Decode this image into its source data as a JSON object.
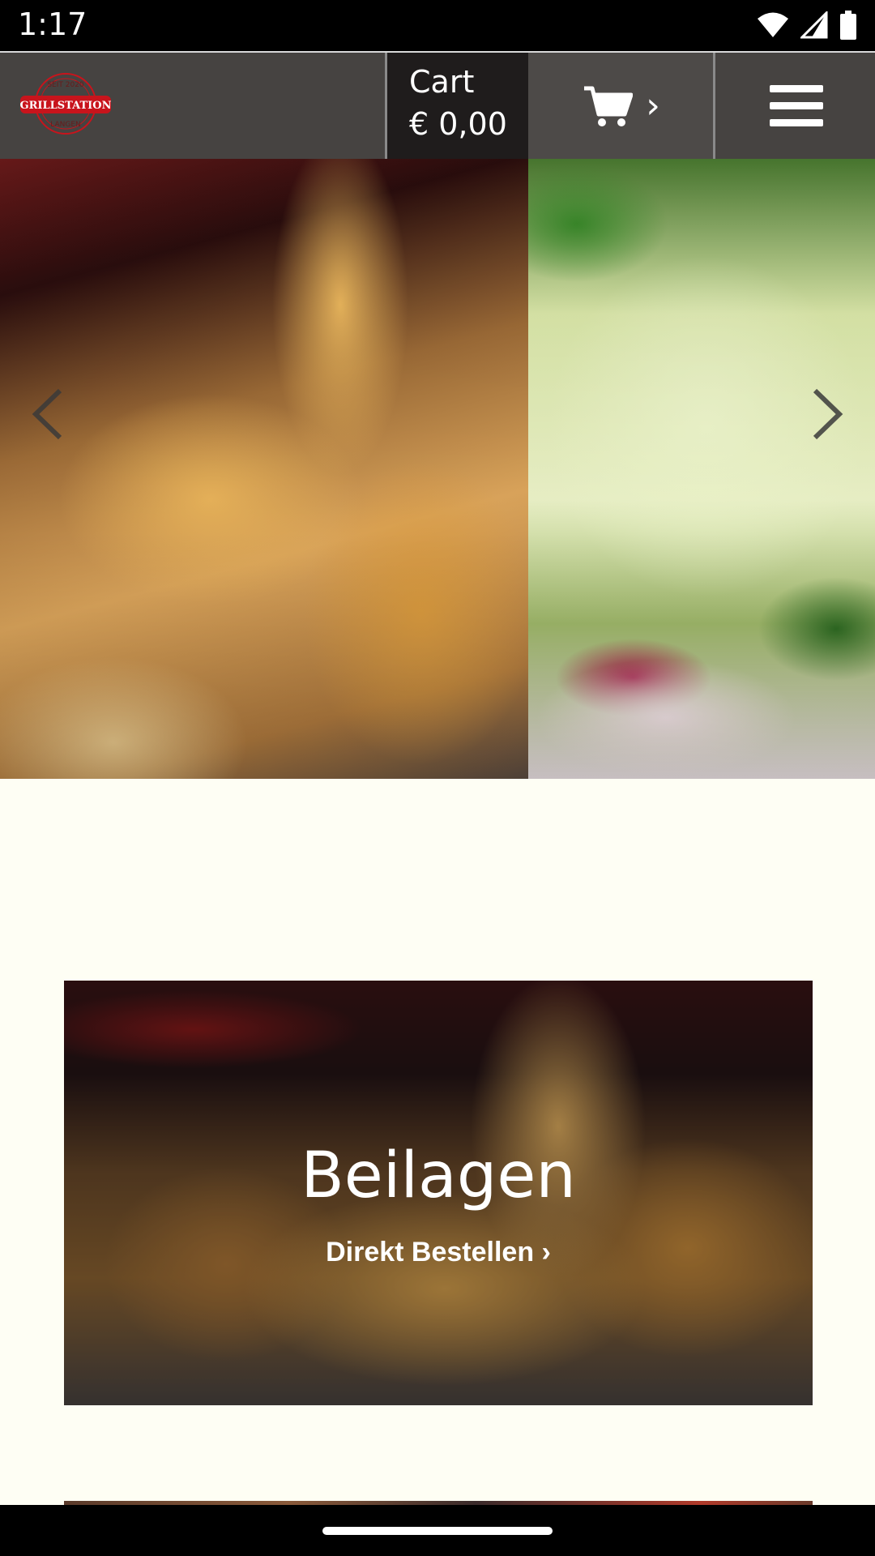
{
  "status_bar": {
    "time": "1:17",
    "icons": [
      "wifi-icon",
      "signal-icon",
      "battery-icon"
    ]
  },
  "header": {
    "logo": {
      "top_text": "SEIT 2020",
      "name": "GRILLSTATION",
      "bottom_text": "LANGEN",
      "brand_color": "#c8141c"
    },
    "cart": {
      "label": "Cart",
      "total": "€ 0,00",
      "chevron": "›",
      "icon": "cart-icon"
    },
    "menu_icon": "hamburger-menu-icon"
  },
  "hero_slider": {
    "slides": [
      "fries-photo",
      "salad-photo"
    ],
    "prev_icon": "chevron-left-icon",
    "next_icon": "chevron-right-icon"
  },
  "category": {
    "title": "Beilagen",
    "link": "Direkt Bestellen ›"
  },
  "colors": {
    "page_background": "#fefef4",
    "header_background": "#181414",
    "text_on_image": "#ffffff"
  }
}
